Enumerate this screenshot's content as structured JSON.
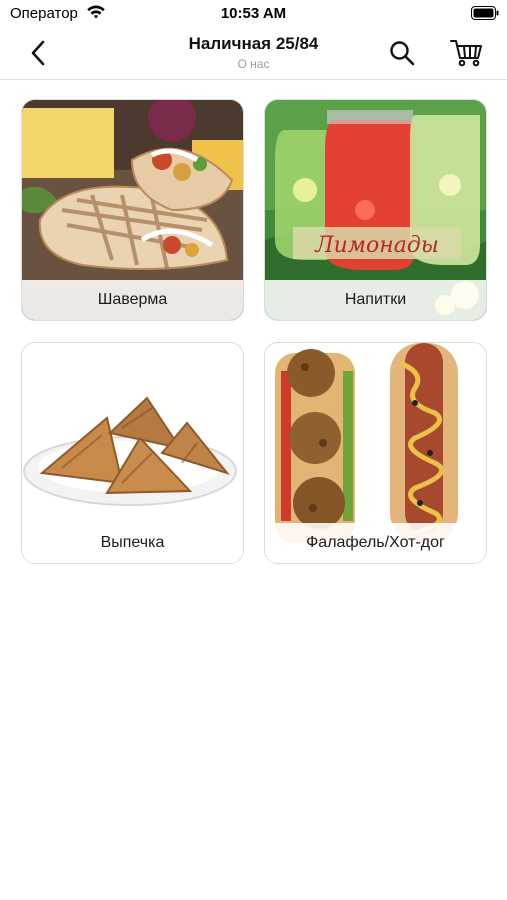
{
  "status_bar": {
    "carrier": "Оператор",
    "time": "10:53 AM"
  },
  "nav": {
    "title": "Наличная 25/84",
    "subtitle": "О нас",
    "icons": {
      "back": "chevron-left-icon",
      "search": "search-icon",
      "cart": "cart-icon"
    }
  },
  "categories": [
    {
      "label": "Шаверма"
    },
    {
      "label": "Напитки",
      "image_text": "Лимонады"
    },
    {
      "label": "Выпечка"
    },
    {
      "label": "Фалафель/Хот-дог"
    }
  ],
  "colors": {
    "accent": "#1c1c1e",
    "divider": "#e1e1e3",
    "subtitle": "#9a9a9e"
  }
}
